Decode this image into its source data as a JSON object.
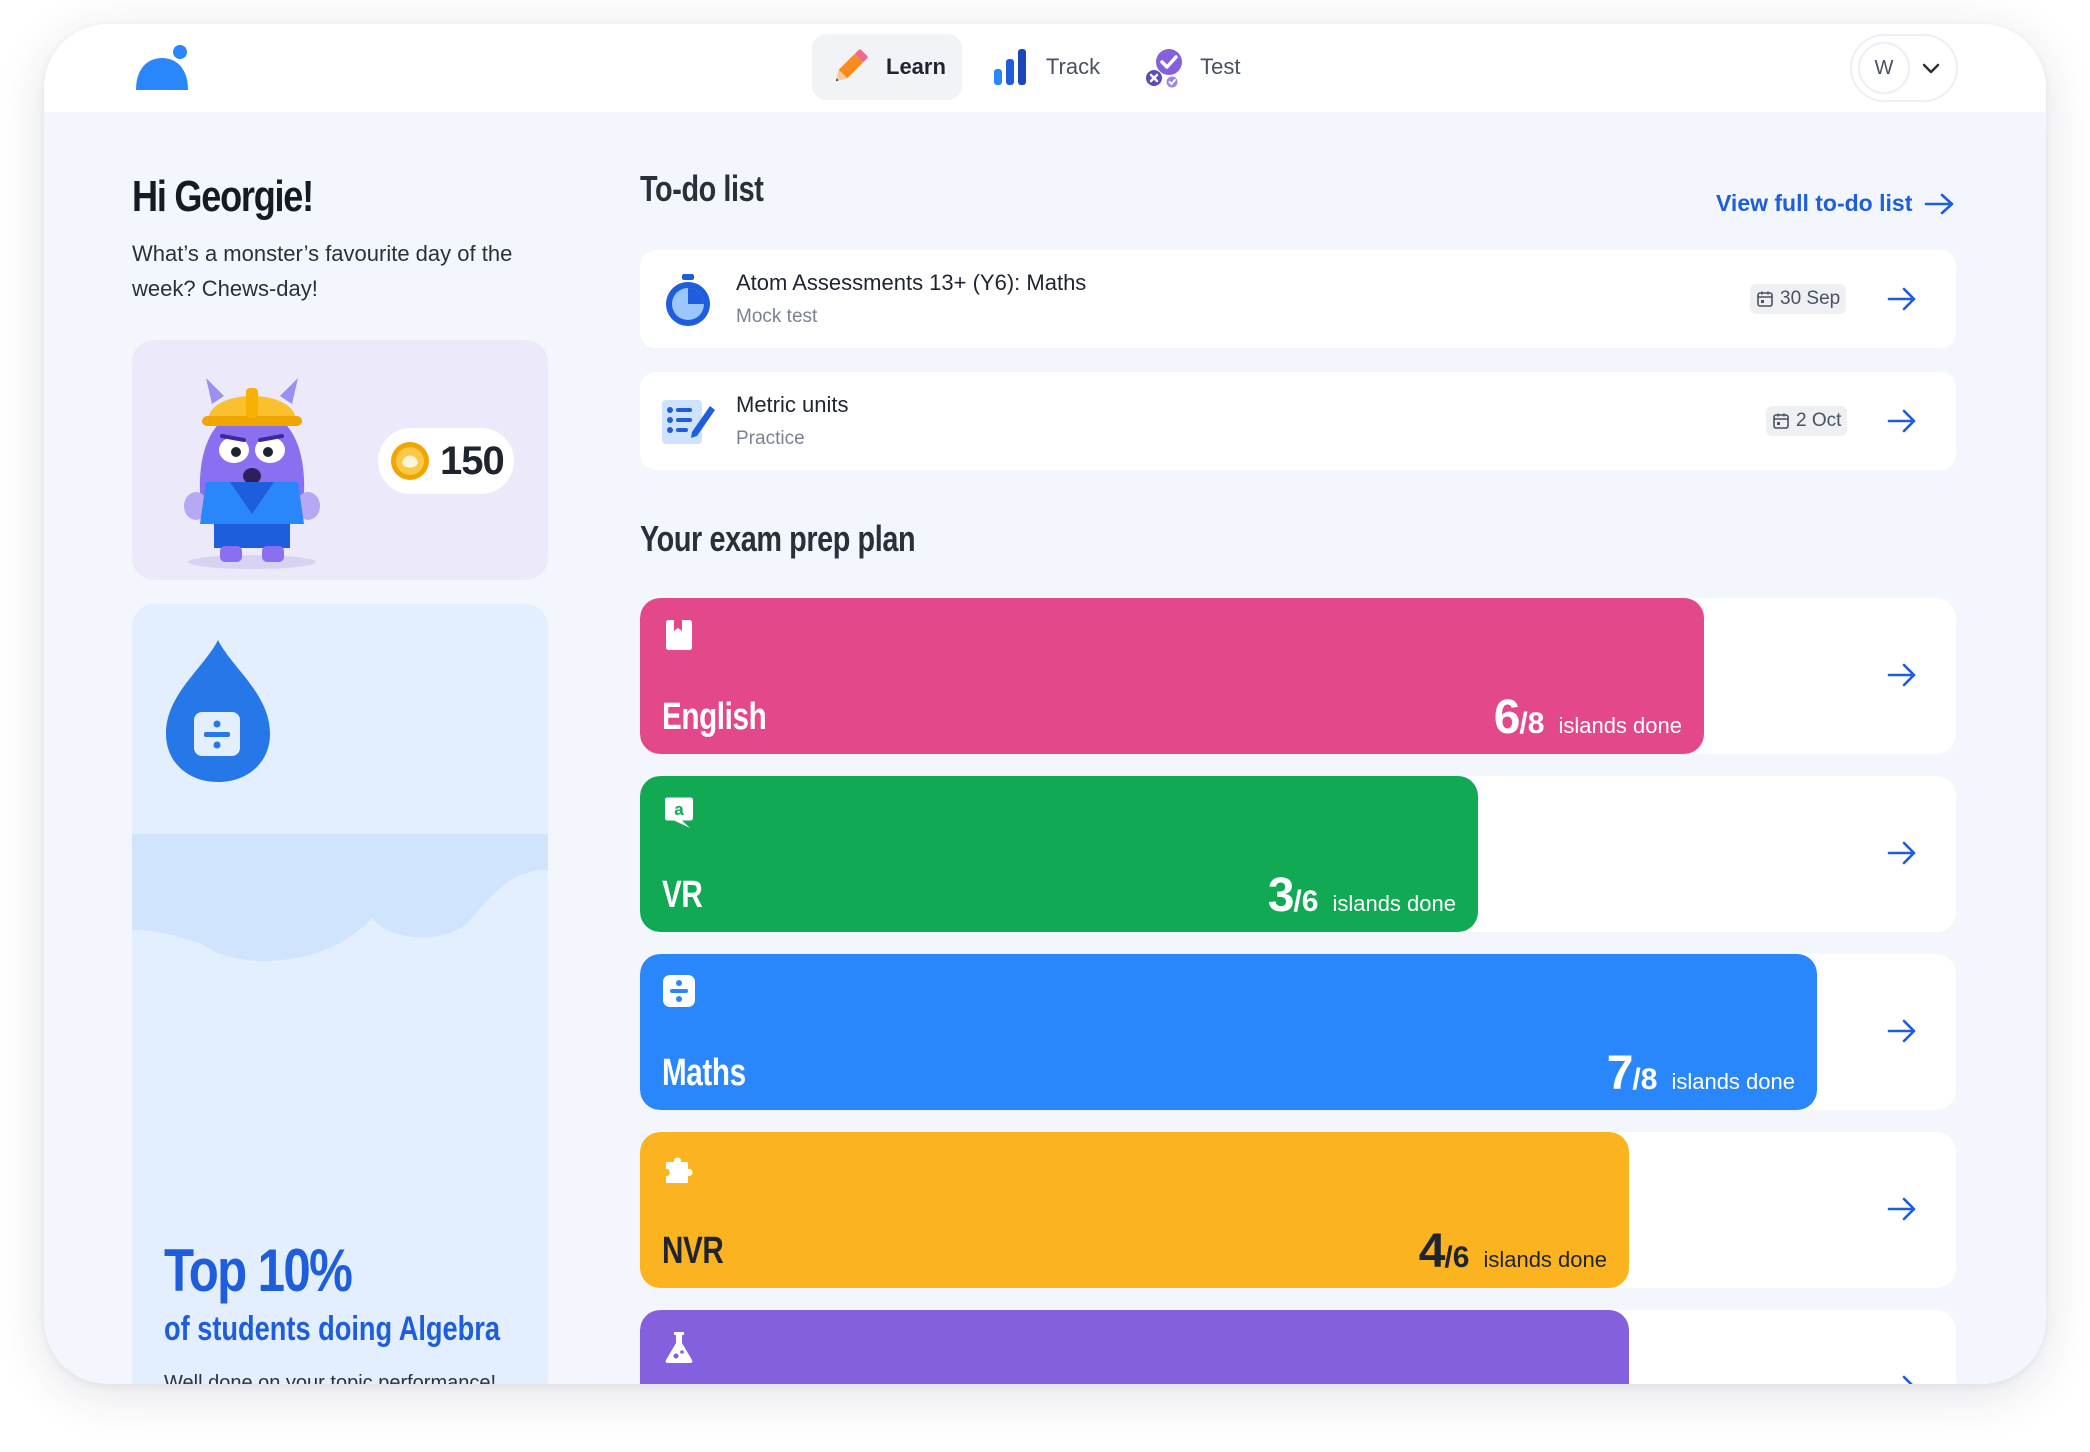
{
  "colors": {
    "brand_blue": "#1e5ddb",
    "english": "#e3488a",
    "vr": "#12a955",
    "maths": "#2a86fb",
    "nvr": "#fbb31f",
    "science": "#8460de"
  },
  "nav": {
    "items": [
      {
        "label": "Learn",
        "icon": "pencil-icon",
        "active": true
      },
      {
        "label": "Track",
        "icon": "bar-chart-icon",
        "active": false
      },
      {
        "label": "Test",
        "icon": "test-check-icon",
        "active": false
      }
    ],
    "avatar_initial": "W"
  },
  "greeting": {
    "title": "Hi Georgie!",
    "joke": "What’s a monster’s favourite day of the week? Chews-day!"
  },
  "coins": {
    "count": "150",
    "icon": "coin-icon"
  },
  "stat": {
    "icon": "maths-drop-icon",
    "headline": "Top 10%",
    "subline": "of students doing Algebra",
    "note": "Well done on your topic performance!"
  },
  "todo": {
    "heading": "To-do list",
    "view_all": "View full to-do list",
    "items": [
      {
        "title": "Atom Assessments 13+ (Y6): Maths",
        "subtitle": "Mock test",
        "date": "30 Sep",
        "icon": "stopwatch-icon"
      },
      {
        "title": "Metric units",
        "subtitle": "Practice",
        "date": "2 Oct",
        "icon": "practice-list-icon"
      }
    ]
  },
  "plan": {
    "heading": "Your exam prep plan",
    "done_label": "islands done",
    "subjects": [
      {
        "name": "English",
        "done": "6",
        "total": "8",
        "progress": 0.75,
        "icon": "book-icon"
      },
      {
        "name": "VR",
        "done": "3",
        "total": "6",
        "progress": 0.5,
        "icon": "speech-a-icon"
      },
      {
        "name": "Maths",
        "done": "7",
        "total": "8",
        "progress": 0.875,
        "icon": "divide-icon"
      },
      {
        "name": "NVR",
        "done": "4",
        "total": "6",
        "progress": 0.667,
        "icon": "puzzle-icon"
      },
      {
        "name": "",
        "done": "",
        "total": "",
        "progress": 0.667,
        "icon": "flask-icon"
      }
    ]
  }
}
